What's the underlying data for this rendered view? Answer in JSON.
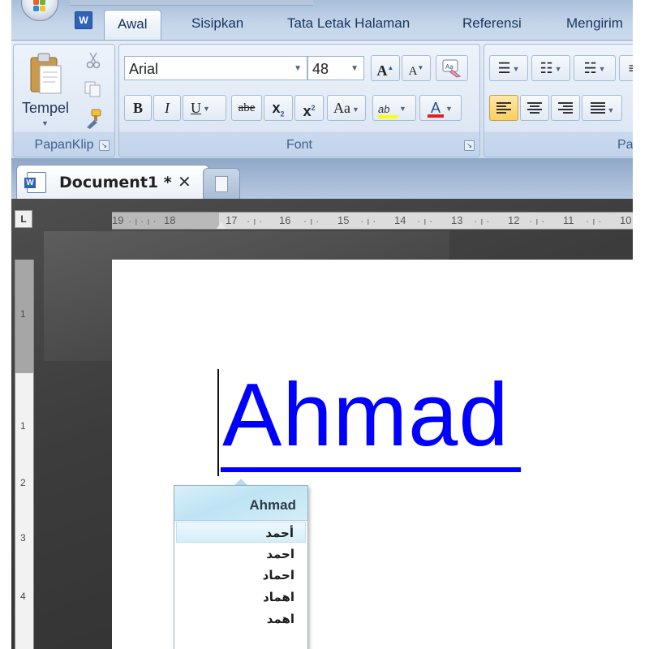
{
  "ribbon": {
    "tabs": [
      "Awal",
      "Sisipkan",
      "Tata Letak Halaman",
      "Referensi",
      "Mengirim"
    ],
    "active_tab": "Awal",
    "clipboard": {
      "paste_label": "Tempel",
      "group_label": "PapanKlip"
    },
    "font": {
      "family": "Arial",
      "size": "48",
      "group_label": "Font",
      "grow_label": "A",
      "shrink_label": "A",
      "bold": "B",
      "italic": "I",
      "underline": "U",
      "strike": "abe",
      "subscript": "x",
      "superscript": "x",
      "change_case": "Aa",
      "highlight": "ab",
      "font_color": "A"
    },
    "paragraph": {
      "group_label": "Par"
    }
  },
  "document": {
    "tab_title": "Document1 *",
    "close_glyph": "✕",
    "text": "Ahmad"
  },
  "ruler": {
    "horizontal": [
      "19",
      "18",
      "17",
      "16",
      "15",
      "14",
      "13",
      "12",
      "11",
      "10"
    ],
    "vertical": [
      "1",
      "1",
      "2",
      "3",
      "4"
    ]
  },
  "suggestions": {
    "header": "Ahmad",
    "items": [
      "أحمد",
      "احمد",
      "احماد",
      "اهماد",
      "اهمد"
    ]
  },
  "colors": {
    "text": "#0000ff",
    "ribbon": "#d5e1f0",
    "workspace": "#3c3c3c",
    "popup_header": "#bfe3f3"
  }
}
